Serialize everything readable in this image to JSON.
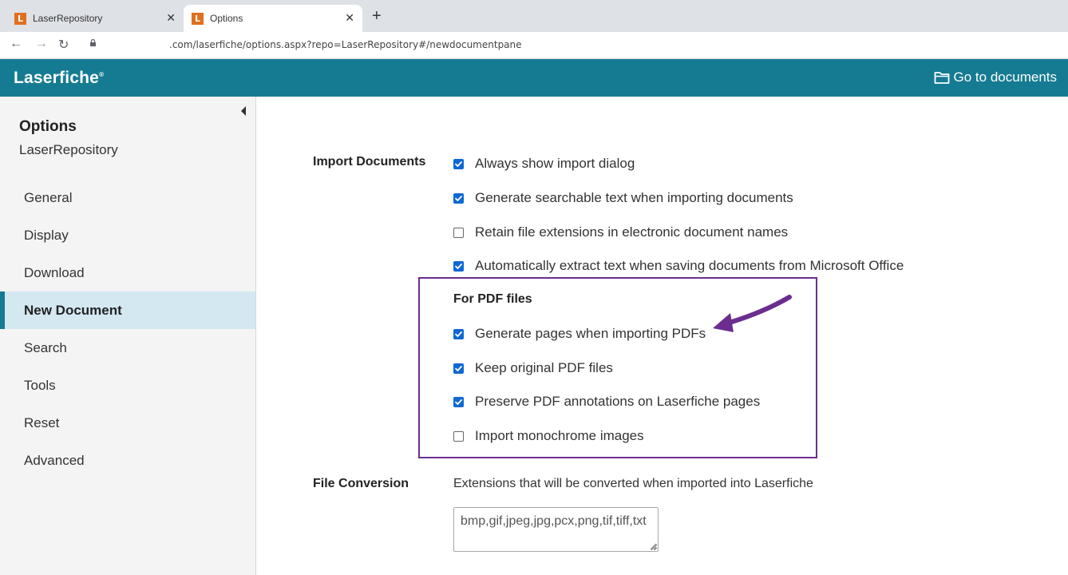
{
  "browser": {
    "tabs": [
      {
        "label": "LaserRepository",
        "icon": "laserfiche-favicon",
        "active": false
      },
      {
        "label": "Options",
        "icon": "laserfiche-favicon",
        "active": true
      }
    ],
    "favicon_letter": "L",
    "url": ".com/laserfiche/options.aspx?repo=LaserRepository#/newdocumentpane"
  },
  "header": {
    "logo": "Laserfiche",
    "goto_label": "Go to documents",
    "color": "#157b92"
  },
  "sidebar": {
    "title": "Options",
    "subtitle": "LaserRepository",
    "items": [
      {
        "label": "General",
        "active": false
      },
      {
        "label": "Display",
        "active": false
      },
      {
        "label": "Download",
        "active": false
      },
      {
        "label": "New Document",
        "active": true
      },
      {
        "label": "Search",
        "active": false
      },
      {
        "label": "Tools",
        "active": false
      },
      {
        "label": "Reset",
        "active": false
      },
      {
        "label": "Advanced",
        "active": false
      }
    ]
  },
  "import_documents": {
    "label": "Import Documents",
    "options": [
      {
        "label": "Always show import dialog",
        "checked": true
      },
      {
        "label": "Generate searchable text when importing documents",
        "checked": true
      },
      {
        "label": "Retain file extensions in electronic document names",
        "checked": false
      },
      {
        "label": "Automatically extract text when saving documents from Microsoft Office",
        "checked": true
      }
    ]
  },
  "pdf_files": {
    "title": "For PDF files",
    "highlight_color": "#6b2d8f",
    "options": [
      {
        "label": "Generate pages when importing PDFs",
        "checked": true
      },
      {
        "label": "Keep original PDF files",
        "checked": true
      },
      {
        "label": "Preserve PDF annotations on Laserfiche pages",
        "checked": true
      },
      {
        "label": "Import monochrome images",
        "checked": false
      }
    ]
  },
  "file_conversion": {
    "label": "File Conversion",
    "description": "Extensions that will be converted when imported into Laserfiche",
    "extensions_value": "bmp,gif,jpeg,jpg,pcx,png,tif,tiff,txt"
  },
  "checkbox_color": "#0f68d4"
}
